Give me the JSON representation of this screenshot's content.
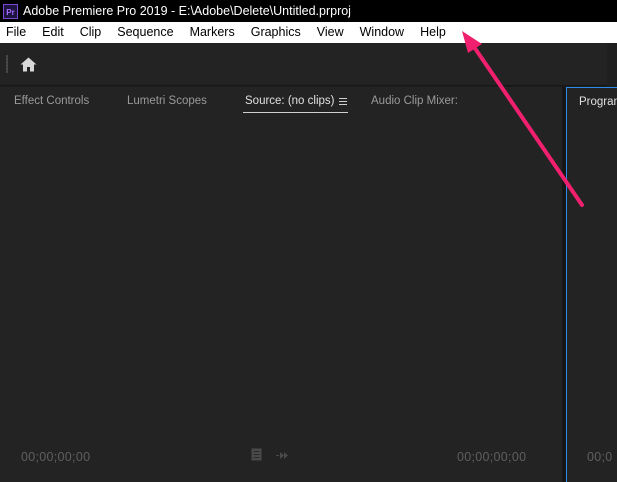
{
  "window": {
    "app_icon_text": "Pr",
    "title": "Adobe Premiere Pro 2019 - E:\\Adobe\\Delete\\Untitled.prproj"
  },
  "menubar": {
    "items": [
      "File",
      "Edit",
      "Clip",
      "Sequence",
      "Markers",
      "Graphics",
      "View",
      "Window",
      "Help"
    ]
  },
  "toolbar": {
    "home_icon": "home-icon"
  },
  "source_panel": {
    "tabs": [
      "Effect Controls",
      "Lumetri Scopes",
      "Source: (no clips)",
      "Audio Clip Mixer:"
    ],
    "active_tab": "Source: (no clips)",
    "timecode_left": "00;00;00;00",
    "timecode_right": "00;00;00;00",
    "controls_icons": [
      "settings-icon",
      "export-frame-icon"
    ]
  },
  "program_panel": {
    "tab_label": "Program",
    "timecode": "00;0",
    "focus_color": "#2d8ceb"
  },
  "annotation": {
    "arrow_color": "#f0206e"
  }
}
